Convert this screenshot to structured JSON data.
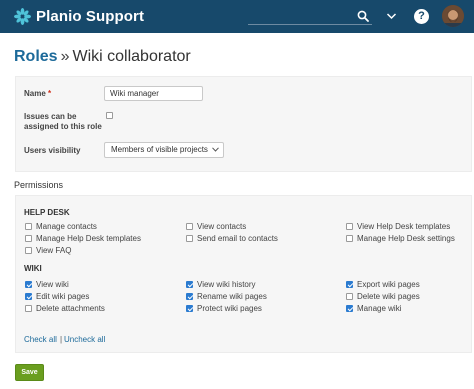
{
  "header": {
    "app_title": "Planio Support",
    "search_placeholder": "",
    "help_label": "?",
    "colors": {
      "bar": "#17496b",
      "logo": "#4fc3d9"
    },
    "icons": [
      "planio-logo-icon",
      "search-icon",
      "chevron-down-icon",
      "help-icon",
      "avatar"
    ]
  },
  "breadcrumb": {
    "parent": "Roles",
    "separator": "»",
    "current": "Wiki collaborator"
  },
  "form": {
    "name_label": "Name",
    "name_required_mark": "*",
    "name_value": "Wiki manager",
    "assignable_label": "Issues can be assigned to this role",
    "assignable_checked": false,
    "visibility_label": "Users visibility",
    "visibility_value": "Members of visible projects"
  },
  "permissions": {
    "heading": "Permissions",
    "groups": [
      {
        "title": "HELP DESK",
        "items": [
          {
            "label": "Manage contacts",
            "checked": false
          },
          {
            "label": "View contacts",
            "checked": false
          },
          {
            "label": "View Help Desk templates",
            "checked": false
          },
          {
            "label": "Manage Help Desk templates",
            "checked": false
          },
          {
            "label": "Send email to contacts",
            "checked": false
          },
          {
            "label": "Manage Help Desk settings",
            "checked": false
          },
          {
            "label": "View FAQ",
            "checked": false
          }
        ]
      },
      {
        "title": "WIKI",
        "items": [
          {
            "label": "View wiki",
            "checked": true
          },
          {
            "label": "View wiki history",
            "checked": true
          },
          {
            "label": "Export wiki pages",
            "checked": true
          },
          {
            "label": "Edit wiki pages",
            "checked": true
          },
          {
            "label": "Rename wiki pages",
            "checked": true
          },
          {
            "label": "Delete wiki pages",
            "checked": false
          },
          {
            "label": "Delete attachments",
            "checked": false
          },
          {
            "label": "Protect wiki pages",
            "checked": true
          },
          {
            "label": "Manage wiki",
            "checked": true
          }
        ]
      }
    ],
    "check_all": "Check all",
    "separator": "|",
    "uncheck_all": "Uncheck all"
  },
  "actions": {
    "save_label": "Save"
  }
}
